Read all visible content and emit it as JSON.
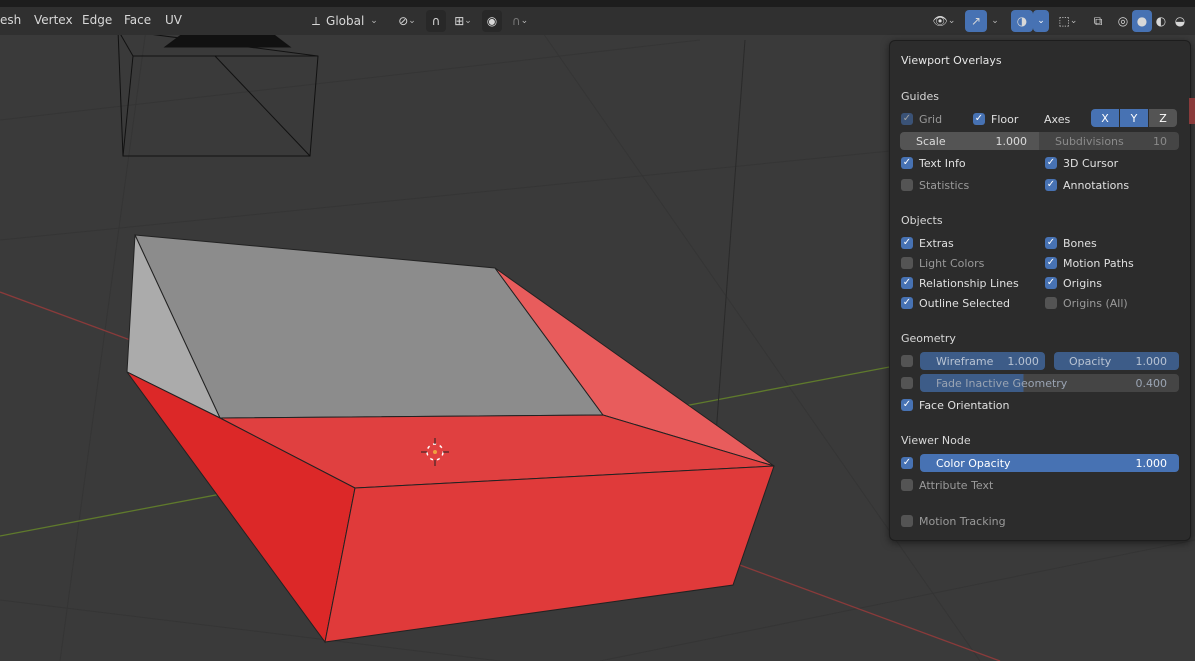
{
  "header": {
    "menus": [
      "esh",
      "Vertex",
      "Edge",
      "Face",
      "UV"
    ],
    "transform_orientation": "Global"
  },
  "panel": {
    "title": "Viewport Overlays",
    "guides": {
      "section": "Guides",
      "grid": "Grid",
      "floor": "Floor",
      "axes_label": "Axes",
      "axes": [
        "X",
        "Y",
        "Z"
      ],
      "scale_label": "Scale",
      "scale_value": "1.000",
      "subdiv_label": "Subdivisions",
      "subdiv_value": "10",
      "text_info": "Text Info",
      "cursor_3d": "3D Cursor",
      "statistics": "Statistics",
      "annotations": "Annotations"
    },
    "objects": {
      "section": "Objects",
      "extras": "Extras",
      "bones": "Bones",
      "light_colors": "Light Colors",
      "motion_paths": "Motion Paths",
      "relationship_lines": "Relationship Lines",
      "origins": "Origins",
      "outline_selected": "Outline Selected",
      "origins_all": "Origins (All)"
    },
    "geometry": {
      "section": "Geometry",
      "wireframe_label": "Wireframe",
      "wireframe_value": "1.000",
      "opacity_label": "Opacity",
      "opacity_value": "1.000",
      "fade_label": "Fade Inactive Geometry",
      "fade_value": "0.400",
      "face_orientation": "Face Orientation"
    },
    "viewer_node": {
      "section": "Viewer Node",
      "color_opacity_label": "Color Opacity",
      "color_opacity_value": "1.000",
      "attribute_text": "Attribute Text"
    },
    "motion_tracking": "Motion Tracking"
  },
  "colors": {
    "viewport_bg": "#3a3a3a",
    "accent": "#4772b3",
    "face_front_red": "#e03a3a",
    "face_gray": "#8c8c8c"
  }
}
